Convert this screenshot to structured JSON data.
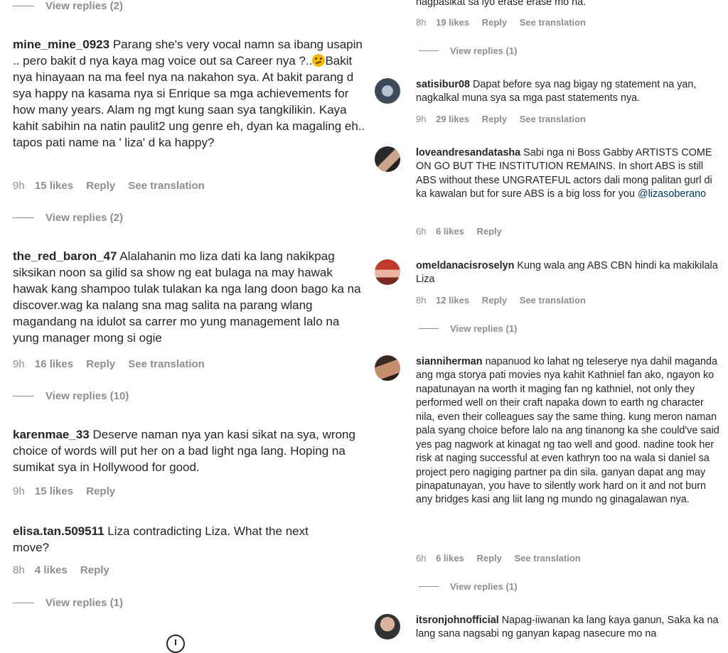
{
  "left": {
    "top_replies": "View replies (2)",
    "comments": [
      {
        "username": "mine_mine_0923",
        "text_before_emoji": "Parang she's very vocal namn sa ibang usapin .. pero bakit d nya kaya mag voice out sa Career nya ?..",
        "text_after_emoji": "Bakit nya hinayaan na ma feel nya na nakahon sya. At bakit parang d sya happy na kasama nya si Enrique sa mga achievements for how many years. Alam ng mgt kung saan sya tangkilikin. Kaya kahit sabihin na natin paulit2 ung genre eh, dyan ka magaling eh.. tapos pati name na ' liza' d ka happy?",
        "time": "9h",
        "likes": "15 likes",
        "reply": "Reply",
        "translation": "See translation",
        "replies": "View replies (2)"
      },
      {
        "username": "the_red_baron_47",
        "text": "Alalahanin mo liza dati ka lang nakikpag siksikan noon sa gilid sa show ng eat bulaga na may hawak hawak kang shampoo tulak tulakan ka nga lang doon bago ka na discover.wag ka nalang sna mag salita na parang wlang magandang na idulot sa carrer mo yung management lalo na yung manager mong si ogie",
        "time": "9h",
        "likes": "16 likes",
        "reply": "Reply",
        "translation": "See translation",
        "replies": "View replies (10)"
      },
      {
        "username": "karenmae_33",
        "text": "Deserve naman nya yan kasi sikat na sya, wrong choice of words will put her on a bad light nga lang. Hoping na sumikat sya in Hollywood for good.",
        "time": "9h",
        "likes": "15 likes",
        "reply": "Reply"
      },
      {
        "username": "elisa.tan.509511",
        "text": "Liza contradicting Liza. What the next move?",
        "time": "8h",
        "likes": "4 likes",
        "reply": "Reply",
        "replies": "View replies (1)"
      }
    ]
  },
  "right": {
    "top_partial": {
      "text": "nagpasikat sa iyo erase erase mo na.",
      "time": "8h",
      "likes": "19 likes",
      "reply": "Reply",
      "translation": "See translation",
      "replies": "View replies (1)"
    },
    "comments": [
      {
        "username": "satisibur08",
        "text": "Dapat before sya nag bigay ng statement na yan, nagkalkal muna sya sa mga past statements nya.",
        "time": "9h",
        "likes": "29 likes",
        "reply": "Reply",
        "translation": "See translation"
      },
      {
        "username": "loveandresandatasha",
        "text": "Sabi nga ni Boss Gabby ARTISTS COME ON GO BUT THE INSTITUTION REMAINS. In short ABS is still ABS without these UNGRATEFUL actors dali mong palitan gurl di ka kawalan but for sure ABS is a big loss for you",
        "mention": "@lizasoberano",
        "time": "6h",
        "likes": "6 likes",
        "reply": "Reply"
      },
      {
        "username": "omeldanacisroselyn",
        "text": "Kung wala ang ABS CBN hindi ka makikilala Liza",
        "time": "8h",
        "likes": "12 likes",
        "reply": "Reply",
        "translation": "See translation",
        "replies": "View replies (1)"
      },
      {
        "username": "sianniherman",
        "text": "napanuod ko lahat ng teleserye nya dahil maganda ang mga storya pati movies nya kahit Kathniel fan ako, ngayon ko napatunayan na worth it maging fan ng kathniel, not only they performed well on their craft napaka down to earth ng character nila, even their colleagues say the same thing. kung meron naman pala syang choice before lalo na ang tinanong ka she could've said yes pag nagwork at kinagat ng tao well and good. nadine took her risk at naging successful at even kathryn too na wala si daniel sa project pero nagiging partner pa din sila. ganyan dapat ang may pinapatunayan, you have to silently work hard on it and not burn any bridges kasi ang liit lang ng mundo ng ginagalawan nya.",
        "time": "6h",
        "likes": "6 likes",
        "reply": "Reply",
        "translation": "See translation",
        "replies": "View replies (1)"
      },
      {
        "username": "itsronjohnofficial",
        "text": "Napag-iiwanan ka lang kaya ganun, Saka ka na lang sana nagsabi ng ganyan kapag nasecure mo na"
      }
    ]
  }
}
